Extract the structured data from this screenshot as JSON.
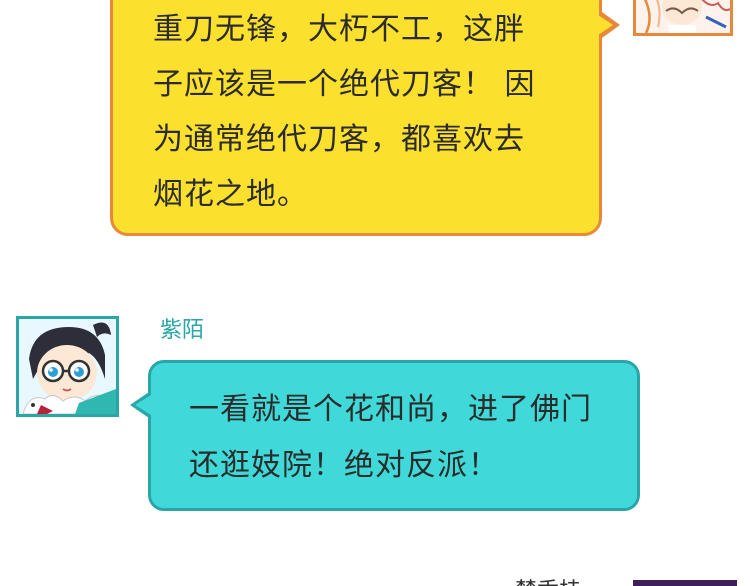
{
  "messages": [
    {
      "side": "right",
      "bubble_color": "#fbe02e",
      "border_color": "#e8893a",
      "avatar": "character-avatar-white-haired-girl",
      "lines": [
        "重刀无锋，大朽不工，这胖",
        "子应该是一个绝代刀客！ 因",
        "为通常绝代刀客，都喜欢去",
        "烟花之地。"
      ]
    },
    {
      "side": "left",
      "bubble_color": "#3fd9d9",
      "border_color": "#2aa6a8",
      "avatar": "character-avatar-ziyang-glasses",
      "username": "紫陌",
      "lines": [
        "一看就是个花和尚，进了佛门",
        "还逛妓院！绝对反派！"
      ]
    }
  ],
  "next_message": {
    "username_partial": "楚香桂",
    "avatar_color": "#3e1f5c"
  }
}
